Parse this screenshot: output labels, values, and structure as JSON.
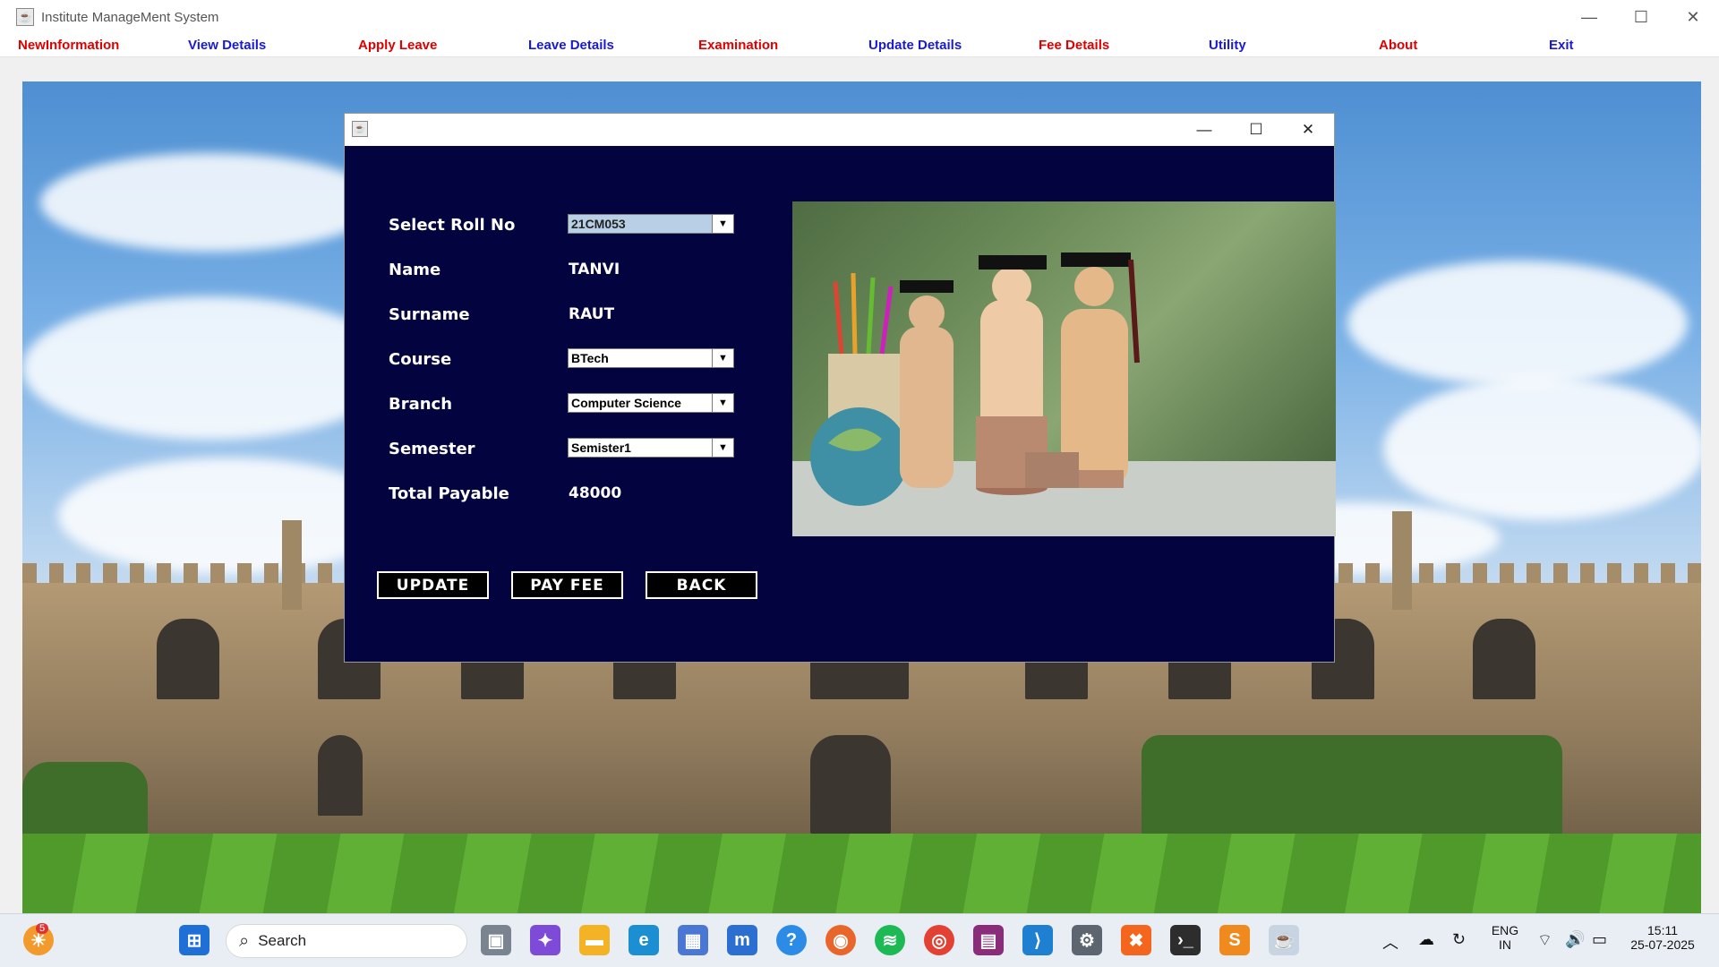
{
  "window": {
    "title": "Institute ManageMent System"
  },
  "menu": [
    {
      "label": "NewInformation",
      "color": "#e00000"
    },
    {
      "label": "View Details",
      "color": "#1a1ad6"
    },
    {
      "label": "Apply Leave",
      "color": "#e00000"
    },
    {
      "label": "Leave Details",
      "color": "#1a1ad6"
    },
    {
      "label": "Examination",
      "color": "#e00000"
    },
    {
      "label": "Update Details",
      "color": "#1a1ad6"
    },
    {
      "label": "Fee Details",
      "color": "#e00000"
    },
    {
      "label": "Utility",
      "color": "#1a1ad6"
    },
    {
      "label": "About",
      "color": "#e00000"
    },
    {
      "label": "Exit",
      "color": "#1a1ad6"
    }
  ],
  "form": {
    "roll_label": "Select Roll No",
    "roll_value": "21CM053",
    "name_label": "Name",
    "name_value": "TANVI",
    "surname_label": "Surname",
    "surname_value": "RAUT",
    "course_label": "Course",
    "course_value": "BTech",
    "branch_label": "Branch",
    "branch_value": "Computer Science",
    "semester_label": "Semester",
    "semester_value": "Semister1",
    "total_label": "Total Payable",
    "total_value": "48000"
  },
  "buttons": {
    "update": "UPDATE",
    "pay_fee": "PAY FEE",
    "back": "BACK"
  },
  "taskbar": {
    "search_label": "Search",
    "notification_count": "5",
    "language_line1": "ENG",
    "language_line2": "IN",
    "time": "15:11",
    "date": "25-07-2025"
  },
  "colors": {
    "dialog_bg": "#03033f",
    "menu_red": "#e00000",
    "menu_blue": "#1a1ad6"
  }
}
